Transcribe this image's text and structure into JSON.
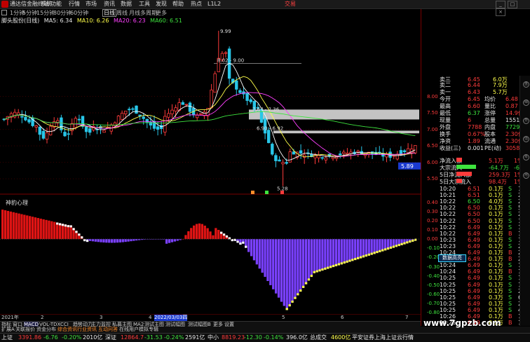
{
  "window": {
    "app_title": "通达信金融终端",
    "menu": [
      "系统",
      "功能",
      "行情",
      "市场",
      "资讯",
      "数据",
      "工具",
      "发现",
      "帮助",
      "热点",
      "L1L2"
    ],
    "trade_label": "交易",
    "winbtns": [
      "_",
      "□",
      "×"
    ]
  },
  "periods": [
    "1分钟",
    "5分钟",
    "15分钟",
    "30分钟",
    "60分钟",
    "日线",
    "周线",
    "月线",
    "多周期",
    "更多"
  ],
  "active_period": "日线",
  "ma_legend": {
    "stock": "脚头股份(日线)",
    "ma5": "MA5: 6.34",
    "ma10": "MA10: 6.26",
    "ma20": "MA20: 6.23",
    "ma60": "MA60: 6.51"
  },
  "colors": {
    "up": "#ff3b3b",
    "down": "#29c6e8",
    "ma5": "#ffffff",
    "ma10": "#ffff4a",
    "ma20": "#ff40ff",
    "ma60": "#3ee33e",
    "osc_neg": "#7a40ff",
    "osc_pos": "#e01414",
    "osc_tip": "#ffff4a",
    "tip_white": "#ffffff"
  },
  "price_axis": [
    "8.00",
    "7.50",
    "7.00",
    "6.50",
    "6.00",
    "5.50"
  ],
  "price_tag": "5.89",
  "annotations": {
    "high": "9.99",
    "a1": "8.02 - 9.00",
    "a2": "7.67 - 7.36",
    "a3": "6.90 - 6.92",
    "low": "5.28"
  },
  "indicator_title": "神豹心理",
  "osc_axis": [
    "0.40",
    "0.30",
    "0.20",
    "0.10",
    "0.00",
    "-0.10",
    "-0.20",
    "-0.30",
    "-0.40",
    "-0.50",
    "-0.60",
    "-0.70",
    "-0.80"
  ],
  "tooltip": "数据高亮",
  "dates": [
    "2021年",
    "2",
    "3",
    "4",
    "2022/03/03四",
    "5",
    "6",
    "7"
  ],
  "tabs1": [
    "指标",
    "窗口",
    "MACD",
    "VOL-TDX",
    "CCI",
    "趋势动力",
    "主力监控",
    "私募主图",
    "MA2",
    "测试主图",
    "测试幅图",
    "测试幅图B",
    "更多",
    "设置"
  ],
  "tabs2": [
    "扩展A",
    "关联报价",
    "资金分布",
    "综合资讯",
    "行业资讯",
    "互动问答",
    "在线用户模拟专辑"
  ],
  "status": {
    "sh_label": "上证",
    "sh_val": "3391.86",
    "sh_chg": "-6.76",
    "sh_pct": "-0.20%",
    "sh_amt": "2010亿",
    "sz_label": "深证",
    "sz_val": "12864.7",
    "sz_chg": "-31.53",
    "sz_pct": "-0.24%",
    "sz_amt": "2591亿",
    "zx_label": "中小",
    "zx_val": "8819.23",
    "zx_chg": "-12.30",
    "zx_pct": "-0.14%",
    "zx_amt": "396.0亿",
    "total_label": "总成交",
    "total_val": "4600亿",
    "broker": "平安证券上海上证云行情"
  },
  "watermark": "www.7gpzb.com",
  "quotes": {
    "asks": [
      {
        "label": "卖三",
        "price": "6.45",
        "vol": "6.0万"
      },
      {
        "label": "卖二",
        "price": "6.44",
        "vol": "7.9万"
      },
      {
        "label": "卖一",
        "price": "6.43",
        "vol": "5.7万"
      }
    ],
    "stats": [
      {
        "l1": "今开",
        "v1": "6.45",
        "l2": "均价",
        "v2": "6.48"
      },
      {
        "l1": "最高",
        "v1": "6.60",
        "l2": "量比",
        "v2": "0.87"
      },
      {
        "l1": "最低",
        "v1": "6.37",
        "l2": "涨停",
        "v2": "14.9亿"
      },
      {
        "l1": "现量",
        "v1": "6",
        "l2": "总量",
        "v2": "15517"
      },
      {
        "l1": "外盘",
        "v1": "7788",
        "l2": "内盘",
        "v2": "7729"
      },
      {
        "l1": "换手",
        "v1": "0.67%",
        "l2": "股本",
        "v2": "2.30亿"
      },
      {
        "l1": "净资",
        "v1": "1.89",
        "l2": "流通",
        "v2": "2.30亿"
      },
      {
        "l1": "收益(三)",
        "v1": "0.001",
        "l2": "PE(动)",
        "v2": "3058.8"
      }
    ],
    "flows": [
      {
        "label": "净流入额",
        "val": "5.1万",
        "pct": "1%"
      },
      {
        "label": "大宗流入",
        "val": "-64.7万",
        "pct": "-6%"
      },
      {
        "label": "5日净流入额",
        "val": "259.3万",
        "pct": "1%"
      },
      {
        "label": "5日大宗流入",
        "val": "98.4万",
        "pct": "1%"
      }
    ],
    "ticks": [
      {
        "t": "10:20",
        "p": "6.51",
        "v": "0.1万",
        "f": "S",
        "n": "1"
      },
      {
        "t": "10:21",
        "p": "6.51",
        "v": "0.1万",
        "f": "S",
        "n": "2"
      },
      {
        "t": "10:22",
        "p": "6.50",
        "p_c": "g",
        "v": "4.0万",
        "f": "S",
        "n": "2"
      },
      {
        "t": "10:22",
        "p": "6.50",
        "v": "0.1万",
        "f": "S",
        "n": "5"
      },
      {
        "t": "10:22",
        "p": "6.50",
        "v": "0.1万",
        "f": "S",
        "n": "2"
      },
      {
        "t": "10:22",
        "p": "6.50",
        "v": "0.1万",
        "f": "S",
        "n": "1"
      },
      {
        "t": "10:22",
        "p": "6.49",
        "v": "0.1万",
        "f": "S",
        "n": "1"
      },
      {
        "t": "10:22",
        "p": "6.49",
        "v": "0.1万",
        "f": "B",
        "n": "1"
      },
      {
        "t": "10:23",
        "p": "6.49",
        "v": "0.1万",
        "f": "S",
        "n": "1"
      },
      {
        "t": "10:23",
        "p": "6.49",
        "v": "0.1万",
        "f": "S",
        "n": "2"
      },
      {
        "t": "10:24",
        "p": "6.49",
        "v": "0.1万",
        "f": "B",
        "n": "2"
      },
      {
        "t": "10:24",
        "p": "6.49",
        "v": "0.1万",
        "f": "B",
        "n": "2"
      },
      {
        "t": "10:24",
        "p": "6.49",
        "v": "0.1万",
        "f": "S",
        "n": "1"
      },
      {
        "t": "10:24",
        "p": "6.49",
        "v": "0.1万",
        "f": "B",
        "n": "1"
      },
      {
        "t": "10:25",
        "p": "6.49",
        "v": "0.1万",
        "f": "S",
        "n": "1"
      },
      {
        "t": "10:25",
        "p": "6.49",
        "v": "0.1万",
        "f": "S",
        "n": "1"
      },
      {
        "t": "10:25",
        "p": "6.49",
        "v": "0.1万",
        "f": "S",
        "n": "2"
      },
      {
        "t": "10:25",
        "p": "6.49",
        "v": "0.3万",
        "f": "S",
        "n": "6"
      },
      {
        "t": "10:25",
        "p": "6.49",
        "v": "0.1万",
        "f": "S",
        "n": "2"
      },
      {
        "t": "10:25",
        "p": "6.49",
        "v": "0.1万",
        "f": "S",
        "n": "4"
      },
      {
        "t": "10:26",
        "p": "6.49",
        "v": "0.1万",
        "f": "B",
        "n": "1"
      },
      {
        "t": "10:26",
        "p": "6.49",
        "v": "0.1万",
        "f": "B",
        "n": "1"
      }
    ],
    "bottom_tabs": [
      "盘",
      "细",
      "势",
      "值",
      "筹",
      "用"
    ]
  }
}
